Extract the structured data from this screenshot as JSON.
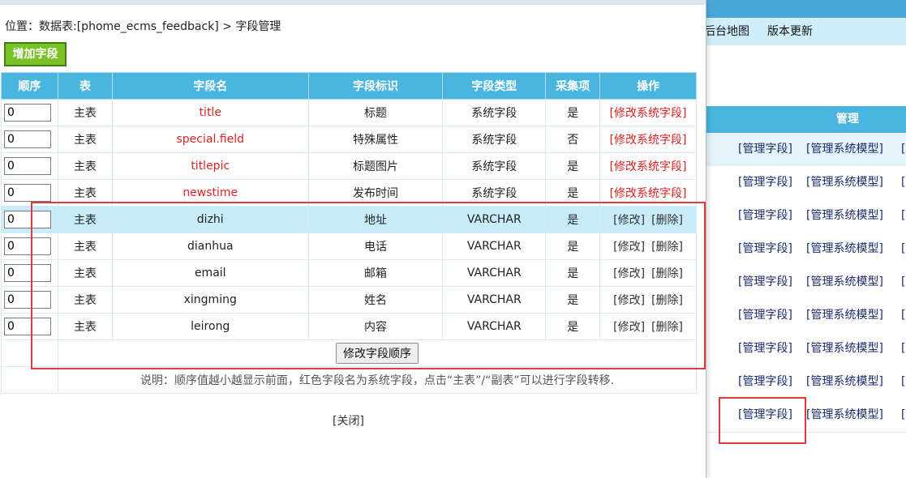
{
  "background": {
    "menu": [
      "后台地图",
      "版本更新"
    ],
    "table_header": "管理",
    "row_links": [
      "[管理字段]",
      "[管理系统模型]",
      "["
    ]
  },
  "popup": {
    "breadcrumb": "位置：数据表:[phome_ecms_feedback] > 字段管理",
    "add_button": "增加字段",
    "columns": [
      "顺序",
      "表",
      "字段名",
      "字段标识",
      "字段类型",
      "采集项",
      "操作"
    ],
    "rows": [
      {
        "order": "0",
        "table": "主表",
        "name": "title",
        "label": "标题",
        "type": "系统字段",
        "collect": "是",
        "system": true
      },
      {
        "order": "0",
        "table": "主表",
        "name": "special.field",
        "label": "特殊属性",
        "type": "系统字段",
        "collect": "否",
        "system": true
      },
      {
        "order": "0",
        "table": "主表",
        "name": "titlepic",
        "label": "标题图片",
        "type": "系统字段",
        "collect": "是",
        "system": true
      },
      {
        "order": "0",
        "table": "主表",
        "name": "newstime",
        "label": "发布时间",
        "type": "系统字段",
        "collect": "是",
        "system": true
      },
      {
        "order": "0",
        "table": "主表",
        "name": "dizhi",
        "label": "地址",
        "type": "VARCHAR",
        "collect": "是",
        "system": false
      },
      {
        "order": "0",
        "table": "主表",
        "name": "dianhua",
        "label": "电话",
        "type": "VARCHAR",
        "collect": "是",
        "system": false
      },
      {
        "order": "0",
        "table": "主表",
        "name": "email",
        "label": "邮箱",
        "type": "VARCHAR",
        "collect": "是",
        "system": false
      },
      {
        "order": "0",
        "table": "主表",
        "name": "xingming",
        "label": "姓名",
        "type": "VARCHAR",
        "collect": "是",
        "system": false
      },
      {
        "order": "0",
        "table": "主表",
        "name": "leirong",
        "label": "内容",
        "type": "VARCHAR",
        "collect": "是",
        "system": false
      }
    ],
    "sys_action": "[修改系统字段]",
    "edit_action": "[修改]",
    "delete_action": "[删除]",
    "order_button": "修改字段顺序",
    "note": "说明：顺序值越小越显示前面，红色字段名为系统字段，点击“主表”/“副表”可以进行字段转移.",
    "close": "[关闭]"
  },
  "colors": {
    "accent": "#4ab6e0",
    "system_field": "#e02020",
    "add_button": "#7bc12a",
    "highlight_box": "#e03a3a"
  }
}
